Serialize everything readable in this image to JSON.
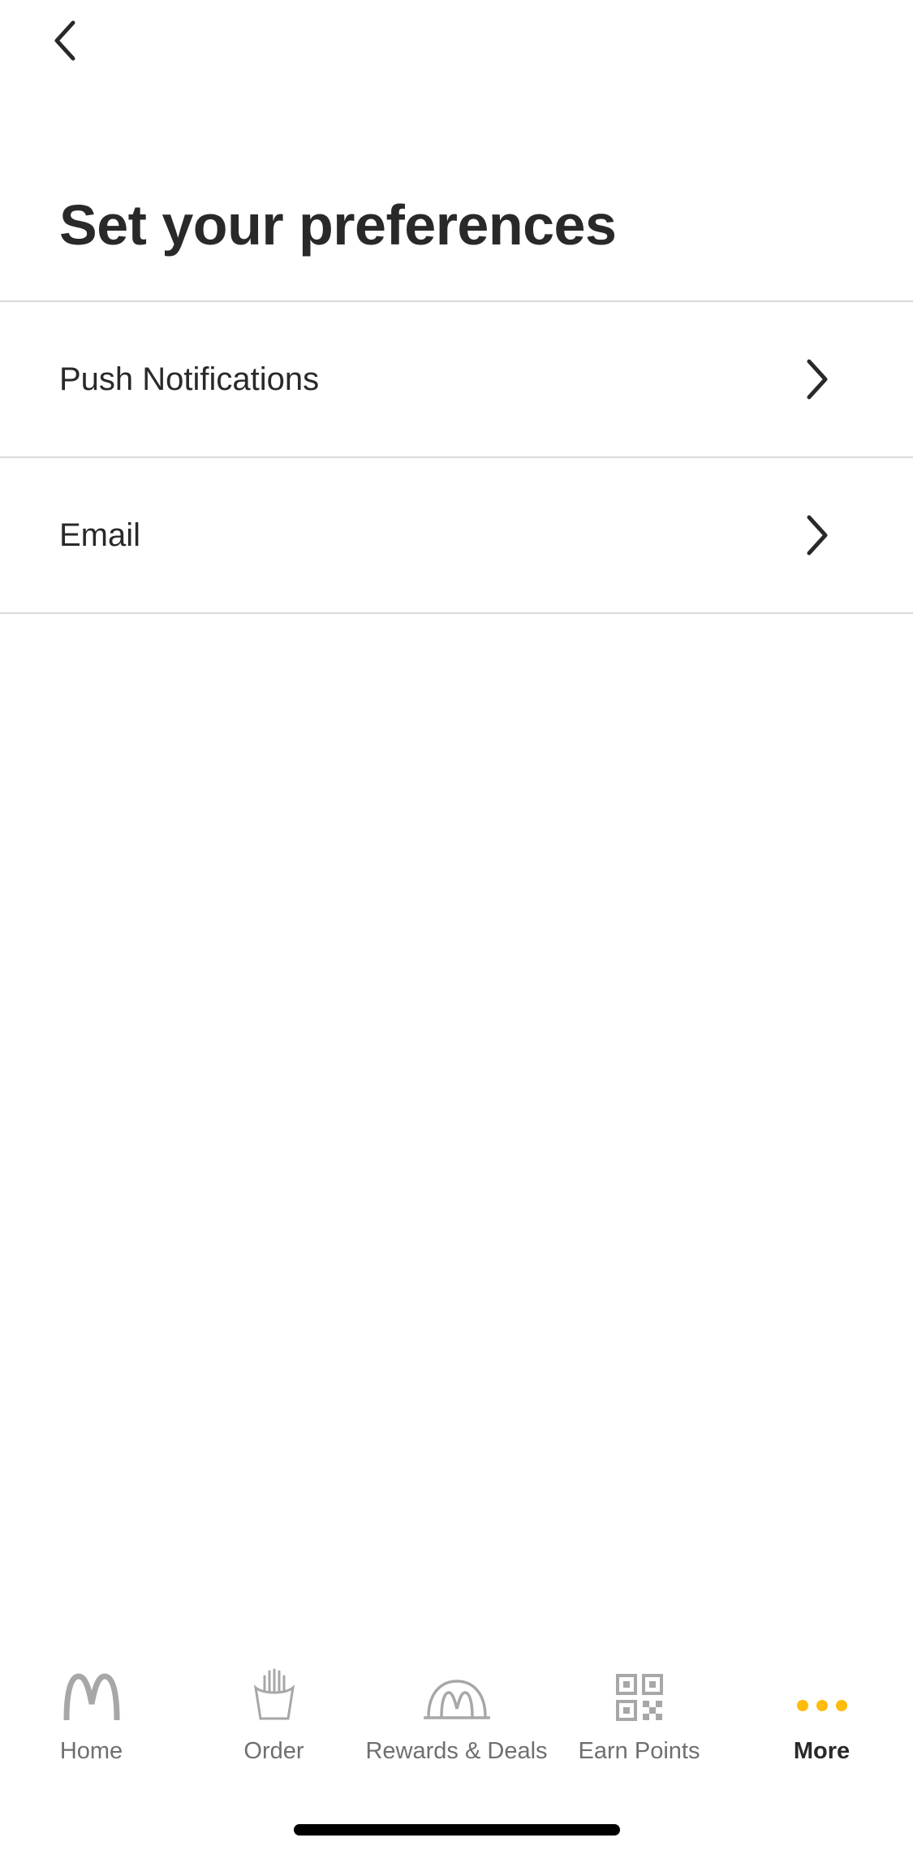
{
  "header": {
    "title": "Set your preferences"
  },
  "preferences": [
    {
      "label": "Push Notifications"
    },
    {
      "label": "Email"
    }
  ],
  "tab_bar": {
    "items": [
      {
        "label": "Home",
        "icon": "golden-arches-icon"
      },
      {
        "label": "Order",
        "icon": "fries-icon"
      },
      {
        "label": "Rewards & Deals",
        "icon": "rewards-arch-icon"
      },
      {
        "label": "Earn Points",
        "icon": "qr-code-icon"
      },
      {
        "label": "More",
        "icon": "more-dots-icon"
      }
    ],
    "active": "More"
  },
  "colors": {
    "text": "#292929",
    "tab_inactive": "#6f6f6f",
    "icon_inactive": "#a7a7a7",
    "accent": "#ffbc0d",
    "divider": "#dadada"
  }
}
